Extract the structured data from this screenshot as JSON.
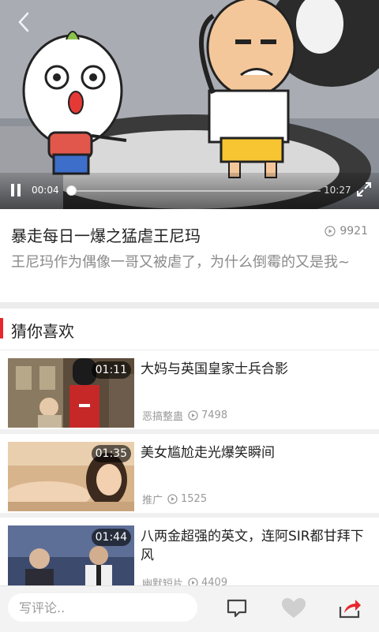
{
  "player": {
    "current_time": "00:04",
    "total_time": "10:27",
    "progress": 0.0064
  },
  "video": {
    "title": "暴走每日一爆之猛虐王尼玛",
    "play_count": "9921",
    "description": "王尼玛作为偶像一哥又被虐了，为什么倒霉的又是我~"
  },
  "recommend": {
    "section_title": "猜你喜欢",
    "items": [
      {
        "title": "大妈与英国皇家士兵合影",
        "duration": "01:11",
        "source": "恶搞整蛊",
        "views": "7498"
      },
      {
        "title": "美女尴尬走光爆笑瞬间",
        "duration": "01:35",
        "source": "推广",
        "views": "1525"
      },
      {
        "title": "八两金超强的英文，连阿SIR都甘拜下风",
        "duration": "01:44",
        "source": "幽默短片",
        "views": "4409"
      }
    ]
  },
  "bottom_bar": {
    "comment_placeholder": "写评论.."
  },
  "colors": {
    "accent": "#e8262d",
    "share_accent": "#e8262d"
  },
  "icons": [
    "back-arrow-icon",
    "pause-icon",
    "fullscreen-icon",
    "play-count-icon",
    "comment-icon",
    "heart-icon",
    "share-icon"
  ]
}
